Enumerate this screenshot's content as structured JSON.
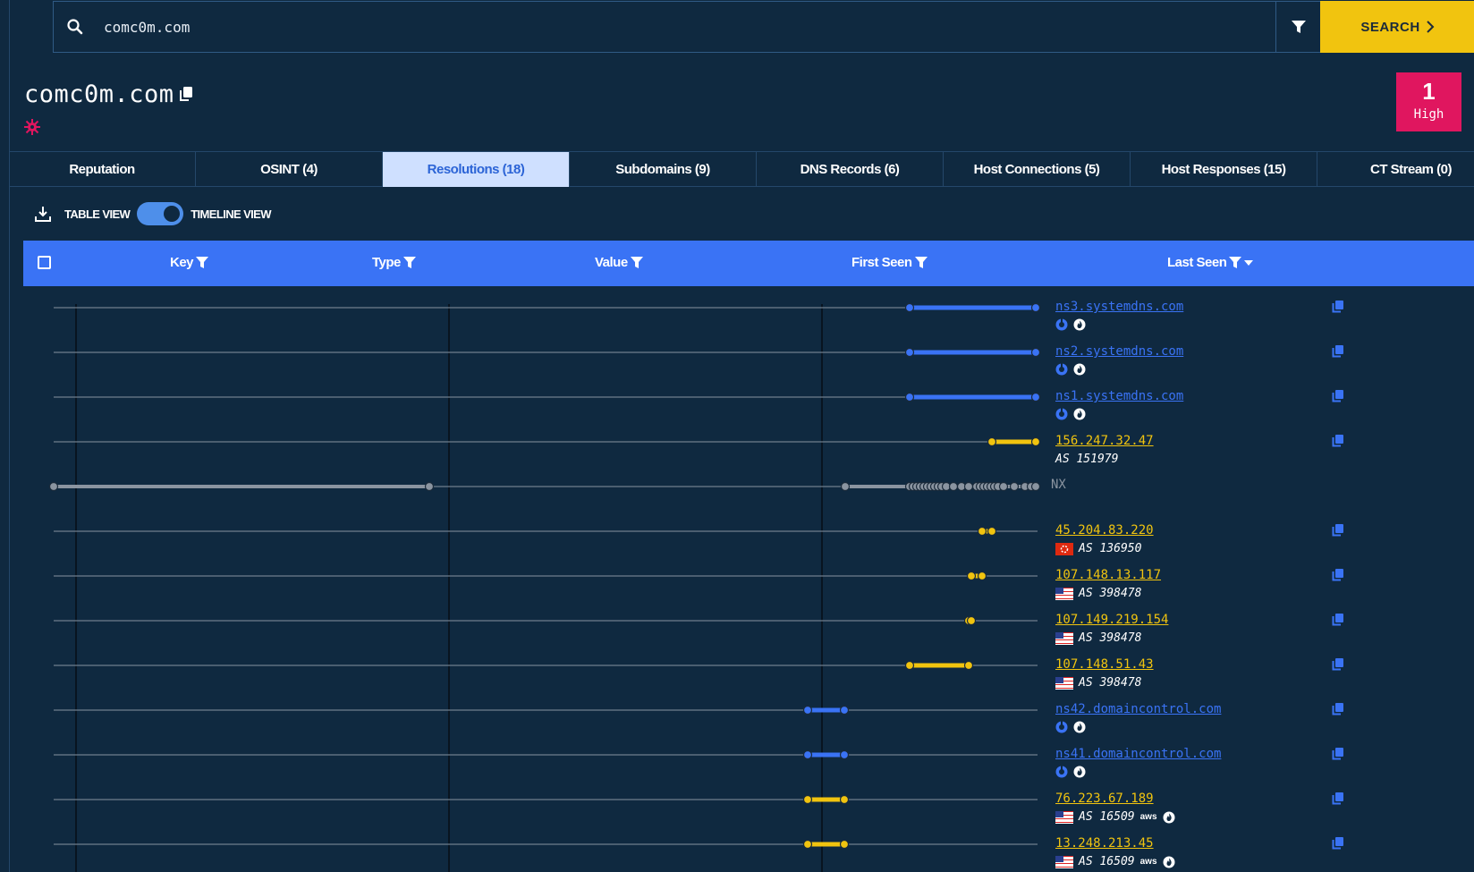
{
  "search": {
    "value": "comc0m.com",
    "button_label": "SEARCH"
  },
  "header": {
    "title": "comc0m.com",
    "risk": {
      "count": "1",
      "level": "High",
      "color": "#e0165f"
    }
  },
  "tabs": [
    {
      "label": "Reputation",
      "active": false
    },
    {
      "label": "OSINT (4)",
      "active": false
    },
    {
      "label": "Resolutions (18)",
      "active": true
    },
    {
      "label": "Subdomains (9)",
      "active": false
    },
    {
      "label": "DNS Records (6)",
      "active": false
    },
    {
      "label": "Host Connections (5)",
      "active": false
    },
    {
      "label": "Host Responses (15)",
      "active": false
    },
    {
      "label": "CT Stream (0)",
      "active": false
    }
  ],
  "view_toggle": {
    "left_label": "TABLE VIEW",
    "right_label": "TIMELINE VIEW",
    "selected": "TIMELINE VIEW"
  },
  "table_headers": [
    "Key",
    "Type",
    "Value",
    "First Seen",
    "Last Seen"
  ],
  "colors": {
    "ns": "#3a73f5",
    "ip": "#f1c40f",
    "nx": "#8a94a0",
    "accent": "#3a73f5",
    "background": "#0f2940"
  },
  "rows": [
    {
      "kind": "ns",
      "value": "ns3.systemdns.com",
      "meta_icons": [
        "dns-icon",
        "fire-icon"
      ]
    },
    {
      "kind": "ns",
      "value": "ns2.systemdns.com",
      "meta_icons": [
        "dns-icon",
        "fire-icon"
      ]
    },
    {
      "kind": "ns",
      "value": "ns1.systemdns.com",
      "meta_icons": [
        "dns-icon",
        "fire-icon"
      ]
    },
    {
      "kind": "ip",
      "value": "156.247.32.47",
      "asn": "AS 151979",
      "flag": ""
    },
    {
      "kind": "nx",
      "value": "NX"
    },
    {
      "kind": "ip",
      "value": "45.204.83.220",
      "asn": "AS 136950",
      "flag": "hk"
    },
    {
      "kind": "ip",
      "value": "107.148.13.117",
      "asn": "AS 398478",
      "flag": "us"
    },
    {
      "kind": "ip",
      "value": "107.149.219.154",
      "asn": "AS 398478",
      "flag": "us"
    },
    {
      "kind": "ip",
      "value": "107.148.51.43",
      "asn": "AS 398478",
      "flag": "us"
    },
    {
      "kind": "ns",
      "value": "ns42.domaincontrol.com",
      "meta_icons": [
        "dns-icon",
        "fire-icon"
      ]
    },
    {
      "kind": "ns",
      "value": "ns41.domaincontrol.com",
      "meta_icons": [
        "dns-icon",
        "fire-icon"
      ]
    },
    {
      "kind": "ip",
      "value": "76.223.67.189",
      "asn": "AS 16509",
      "flag": "us",
      "provider": "aws"
    },
    {
      "kind": "ip",
      "value": "13.248.213.45",
      "asn": "AS 16509",
      "flag": "us",
      "provider": "aws"
    }
  ]
}
